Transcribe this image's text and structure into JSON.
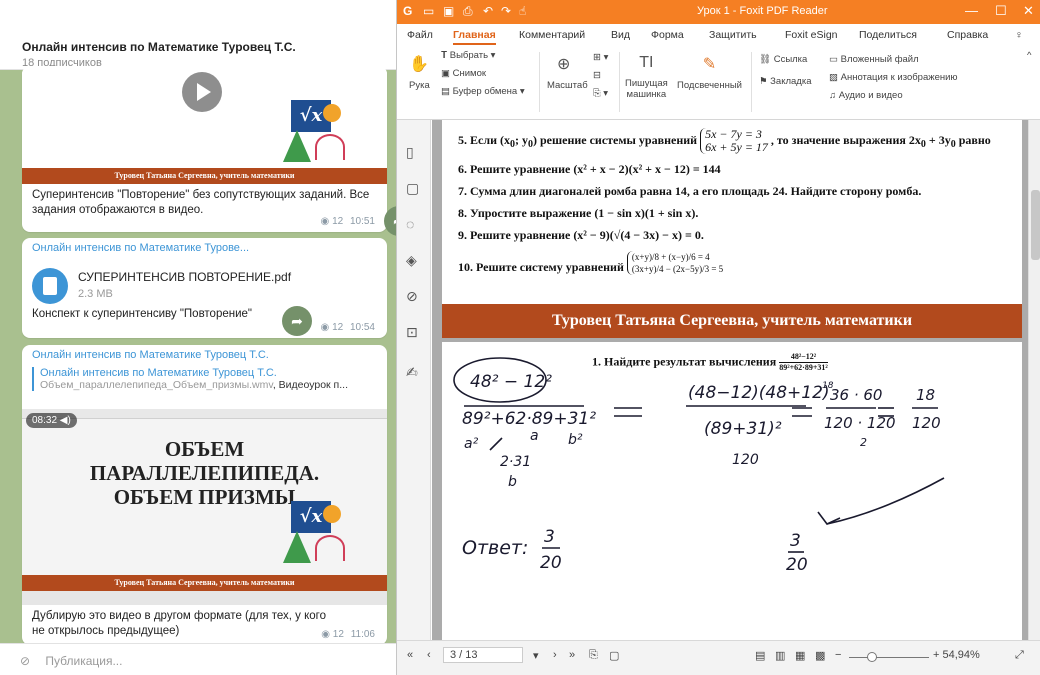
{
  "telegram": {
    "channel_title": "Онлайн интенсив по Математике Туровец Т.С.",
    "subscribers": "18 подписчиков",
    "msg1": {
      "banner": "Туровец Татьяна Сергеевна, учитель математики",
      "caption": "Суперинтенсив \"Повторение\" без сопутствующих заданий. Все задания отображаются в видео.",
      "views": "12",
      "time": "10:51"
    },
    "msg2": {
      "sender": "Онлайн интенсив по Математике Турове...",
      "file_name": "СУПЕРИНТЕНСИВ ПОВТОРЕНИЕ.pdf",
      "file_size": "2.3 MB",
      "caption": "Конспект к суперинтенсиву \"Повторение\"",
      "views": "12",
      "time": "10:54"
    },
    "msg3": {
      "sender": "Онлайн интенсив по Математике Туровец Т.С.",
      "link_title": "Онлайн интенсив по Математике Туровец Т.С.",
      "link_file": "Объем_параллелепипеда_Объем_призмы.wmv",
      "link_rest": ", Видеоурок п...",
      "video_time": "08:32",
      "video_title_1": "ОБЪЕМ",
      "video_title_2": "ПАРАЛЛЕЛЕПИПЕДА.",
      "video_title_3": "ОБЪЕМ ПРИЗМЫ",
      "banner": "Туровец Татьяна Сергеевна, учитель математики",
      "caption": "Дублирую это видео в другом формате (для тех, у кого не открылось предыдущее)",
      "views": "12",
      "time": "11:06"
    },
    "composer_placeholder": "Публикация..."
  },
  "foxit": {
    "title": "Урок 1 - Foxit PDF Reader",
    "menu": [
      "Файл",
      "Главная",
      "Комментарий",
      "Вид",
      "Форма",
      "Защитить",
      "Foxit eSign",
      "Поделиться",
      "Справка"
    ],
    "ribbon": {
      "hand": "Рука",
      "select": "Выбрать",
      "snapshot": "Снимок",
      "clipboard": "Буфер обмена",
      "zoom": "Масштаб",
      "typewriter_1": "Пишущая",
      "typewriter_2": "машинка",
      "highlight": "Подсвеченный",
      "link": "Ссылка",
      "bookmark": "Закладка",
      "attach": "Вложенный файл",
      "image_annot": "Аннотация к изображению",
      "audio_video": "Аудио и видео"
    },
    "doc": {
      "t5_pre": "5. Если (x",
      "t5_mid": "; y",
      "t5_post": ") решение системы уравнений",
      "t5_sys1": "5x − 7y = 3",
      "t5_sys2": "6x + 5y = 17",
      "t5_tail": ", то значение выражения 2x",
      "t5_tail2": " + 3y",
      "t5_tail3": " равно",
      "t6": "6. Решите уравнение (x² + x − 2)(x² + x − 12) = 144",
      "t7": "7. Сумма длин диагоналей ромба равна 14, а его площадь 24. Найдите сторону ромба.",
      "t8": "8. Упростите выражение (1 − sin x)(1 + sin x).",
      "t9": "9. Решите уравнение (x² − 9)(√(4 − 3x) − x) = 0.",
      "t10": "10. Решите систему уравнений",
      "band": "Туровец Татьяна Сергеевна, учитель математики",
      "p2_task": "1. Найдите результат вычисления",
      "p2_frac_num": "48²−12²",
      "p2_frac_den": "89²+62·89+31²",
      "hw": {
        "num": "48² − 12²",
        "den": "89²+62·89+31²",
        "a2": "a²",
        "a": "a",
        "b2": "b²",
        "two_ab": "2·31",
        "b": "b",
        "eq_num": "(48−12)(48+12)",
        "eq_den": "(89+31)²",
        "den_val": "120",
        "s_num": "36 · 60",
        "s_den": "120 · 120",
        "small18": "18",
        "small2": "2",
        "r_num": "18",
        "r_den": "120",
        "final_num": "3",
        "final_den": "20",
        "answer_label": "Ответ:",
        "answer_num": "3",
        "answer_den": "20"
      }
    },
    "status": {
      "page": "3 / 13",
      "zoom": "+ 54,94%"
    }
  }
}
